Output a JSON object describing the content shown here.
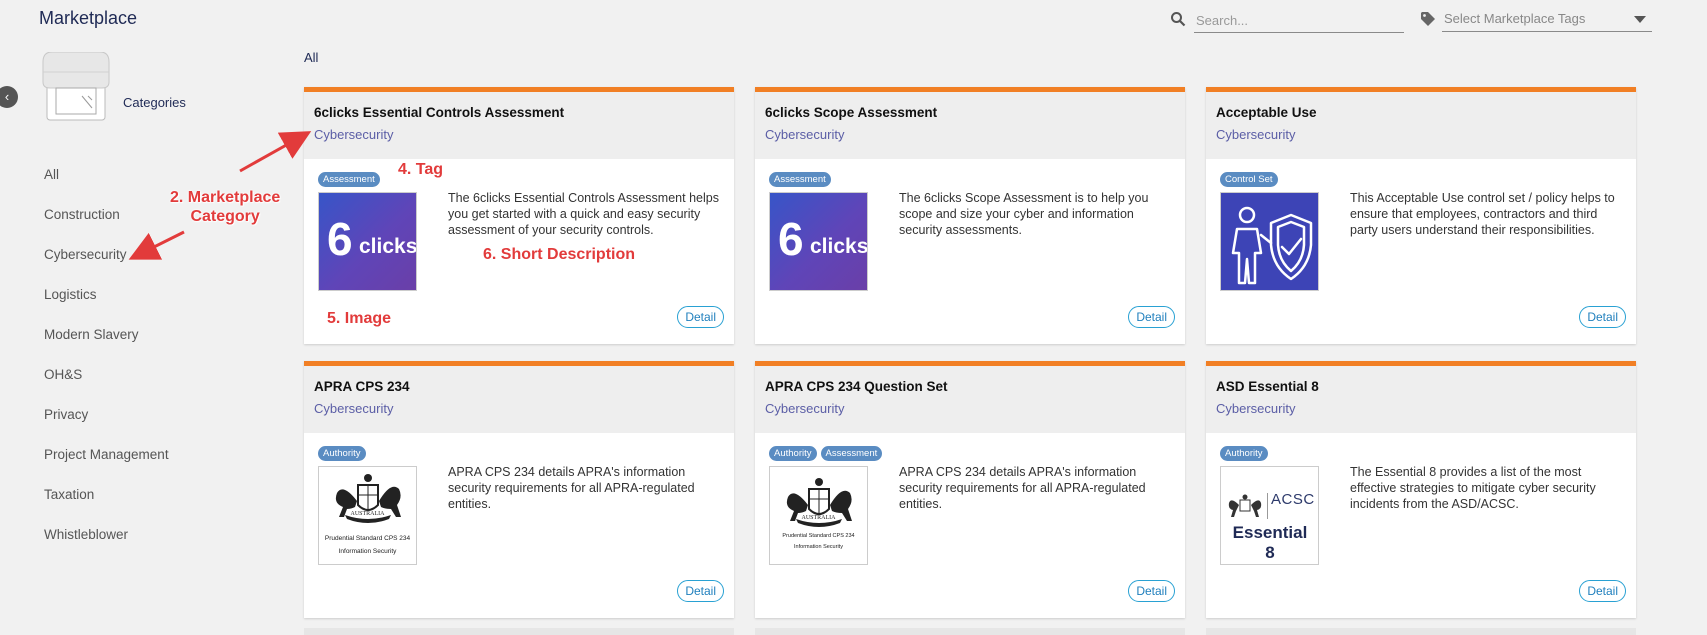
{
  "header": {
    "title": "Marketplace",
    "search_placeholder": "Search...",
    "tags_placeholder": "Select Marketplace Tags"
  },
  "sidebar": {
    "collapse_glyph": "‹",
    "categories_label": "Categories",
    "items": [
      "All",
      "Construction",
      "Cybersecurity",
      "Logistics",
      "Modern Slavery",
      "OH&S",
      "Privacy",
      "Project Management",
      "Taxation",
      "Whistleblower"
    ]
  },
  "filter_label": "All",
  "cards": [
    {
      "title": "6clicks Essential Controls Assessment",
      "category": "Cybersecurity",
      "tags": [
        "Assessment"
      ],
      "image": {
        "kind": "6clicks",
        "text_big": "6",
        "text_small": "clicks"
      },
      "description": "The 6clicks Essential Controls Assessment helps you get started with a quick and easy security assessment of your security controls.",
      "detail_label": "Detail"
    },
    {
      "title": "6clicks Scope Assessment",
      "category": "Cybersecurity",
      "tags": [
        "Assessment"
      ],
      "image": {
        "kind": "6clicks",
        "text_big": "6",
        "text_small": "clicks"
      },
      "description": "The 6clicks Scope Assessment is to help you scope and size your cyber and information security assessments.",
      "detail_label": "Detail"
    },
    {
      "title": "Acceptable Use",
      "category": "Cybersecurity",
      "tags": [
        "Control Set"
      ],
      "image": {
        "kind": "person-shield-icon"
      },
      "description": "This Acceptable Use control set / policy helps to ensure that employees, contractors and third party users understand their responsibilities.",
      "detail_label": "Detail"
    },
    {
      "title": "APRA CPS 234",
      "category": "Cybersecurity",
      "tags": [
        "Authority"
      ],
      "image": {
        "kind": "apra-crest",
        "lines": [
          "AUSTRALIA",
          "Prudential Standard CPS 234",
          "Information Security"
        ]
      },
      "description": "APRA CPS 234 details APRA's information security requirements for all APRA-regulated entities.",
      "detail_label": "Detail"
    },
    {
      "title": "APRA CPS 234 Question Set",
      "category": "Cybersecurity",
      "tags": [
        "Authority",
        "Assessment"
      ],
      "image": {
        "kind": "apra-crest",
        "lines": [
          "AUSTRALIA",
          "Prudential Standard CPS 234",
          "Information Security"
        ]
      },
      "description": "APRA CPS 234 details APRA's information security requirements for all APRA-regulated entities.",
      "detail_label": "Detail"
    },
    {
      "title": "ASD Essential 8",
      "category": "Cybersecurity",
      "tags": [
        "Authority"
      ],
      "image": {
        "kind": "acsc",
        "acsc": "ACSC",
        "title": "Essential 8"
      },
      "description": "The Essential 8 provides a list of the most effective strategies to mitigate cyber security incidents from the ASD/ACSC.",
      "detail_label": "Detail"
    }
  ],
  "annotations": {
    "category_line1": "2. Marketplace",
    "category_line2": "Category",
    "tag": "4. Tag",
    "image": "5. Image",
    "description": "6. Short Description"
  },
  "colors": {
    "accent": "#f17f24",
    "tag_bg": "#5a8cc2",
    "category_text": "#5b5ea6",
    "annotation": "#e23b3b",
    "detail_border": "#29a1d3"
  }
}
